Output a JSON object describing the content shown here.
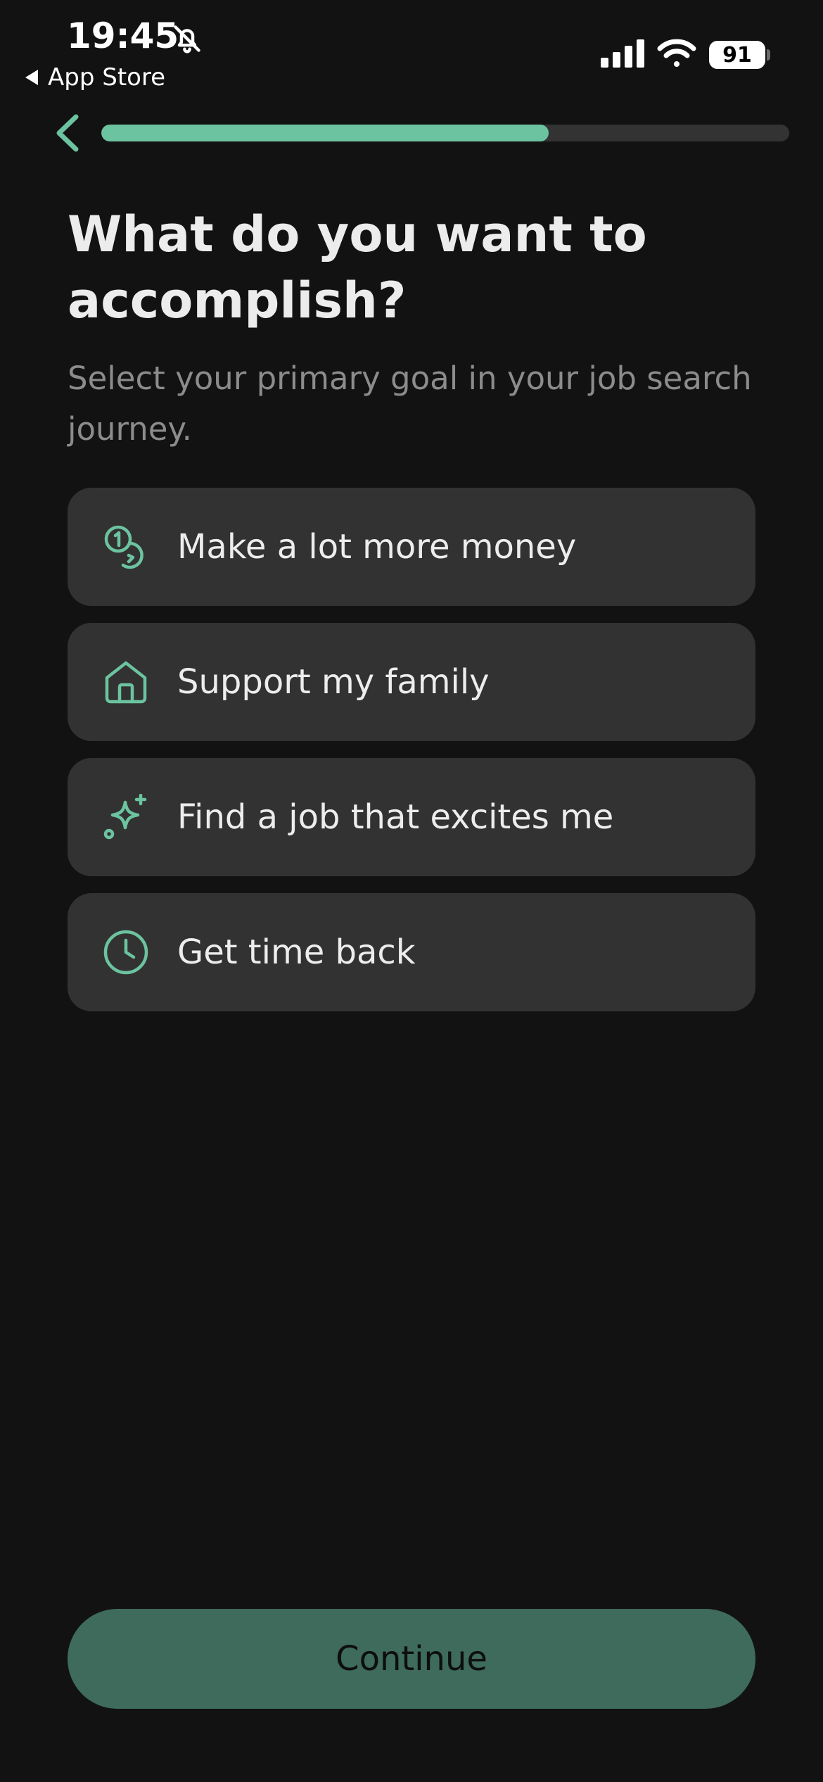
{
  "status_bar": {
    "time": "19:45",
    "back_app_label": "App Store",
    "battery": "91",
    "icons": [
      "bell-slash-icon",
      "cellular-signal-icon",
      "wifi-icon",
      "battery-icon"
    ]
  },
  "nav": {
    "back_icon": "chevron-left-icon",
    "progress_fraction": 0.65
  },
  "header": {
    "title": "What do you want to accomplish?",
    "subtitle": "Select your primary goal in your job search journey."
  },
  "options": [
    {
      "icon": "coins-icon",
      "label": "Make a lot more money"
    },
    {
      "icon": "home-icon",
      "label": "Support my family"
    },
    {
      "icon": "sparkle-icon",
      "label": "Find a job that excites me"
    },
    {
      "icon": "clock-icon",
      "label": "Get time back"
    }
  ],
  "continue_label": "Continue",
  "colors": {
    "accent": "#6cc3a0",
    "background": "#121212",
    "option_bg": "#323232",
    "button_bg": "#3e6b5b"
  }
}
